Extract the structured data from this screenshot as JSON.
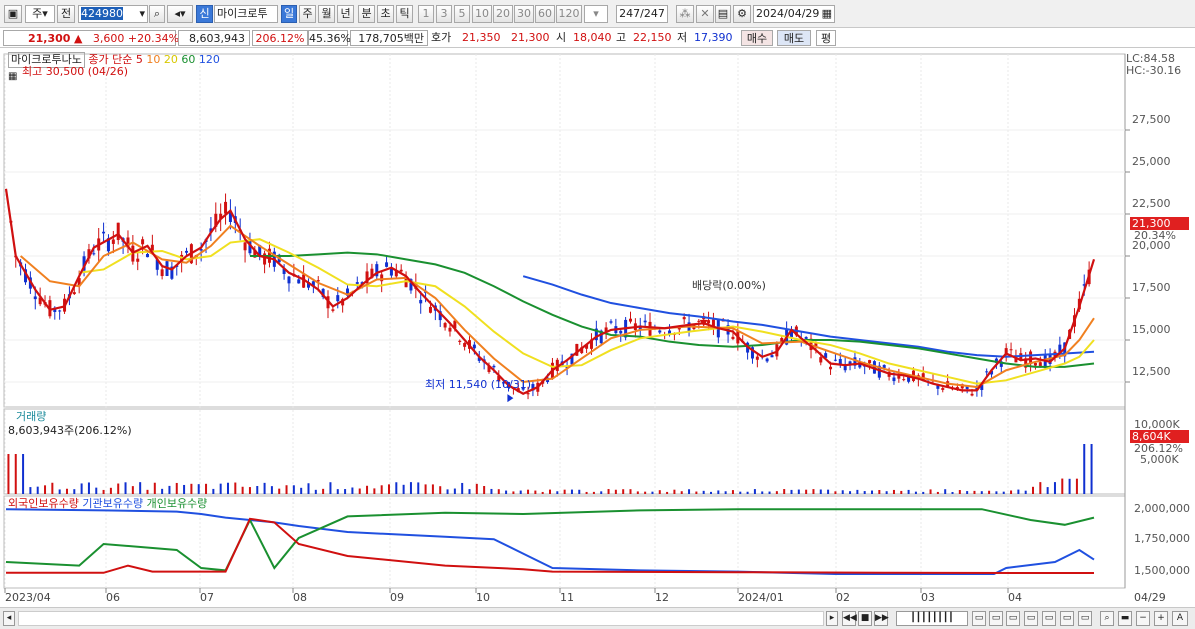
{
  "toolbar": {
    "type_label": "주",
    "prev_label": "전",
    "code": "424980",
    "sel_new": "신",
    "stock_name": "마이크로투",
    "periods": [
      "일",
      "주",
      "월",
      "년",
      "분",
      "초",
      "틱"
    ],
    "intervals": [
      "1",
      "3",
      "5",
      "10",
      "20",
      "30",
      "60",
      "120"
    ],
    "count": "247/247",
    "date": "2024/04/29"
  },
  "info": {
    "price": "21,300",
    "arrow": "▲",
    "change": "3,600",
    "rate": "+20.34%",
    "volume": "8,603,943",
    "vol_rate": "206.12%",
    "turnover": "45.36%",
    "amount": "178,705백만",
    "quote_label": "호가",
    "ask": "21,350",
    "bid": "21,300",
    "open_label": "시",
    "open": "18,040",
    "high_label": "고",
    "high": "22,150",
    "low_label": "저",
    "low": "17,390",
    "buy": "매수",
    "sell": "매도",
    "avg": "평"
  },
  "legend": {
    "name": "마이크로투나노",
    "close": "종가 단순",
    "ma5": "5",
    "ma10": "10",
    "ma20": "20",
    "ma60": "60",
    "ma120": "120",
    "high_note": "최고 30,500 (04/26)",
    "low_note": "최저 11,540 (10/31)",
    "dividend": "배당락(0.00%)"
  },
  "price_axis": {
    "lc": "LC:84.58",
    "hc": "HC:-30.16",
    "ticks": [
      "27,500",
      "25,000",
      "22,500",
      "20,000",
      "17,500",
      "15,000",
      "12,500"
    ],
    "tag_price": "21,300",
    "tag_rate": "20.34%"
  },
  "volume": {
    "title": "거래량",
    "value": "8,603,943주(206.12%)",
    "ticks": [
      "10,000K",
      "5,000K"
    ],
    "tag_vol": "8,604K",
    "tag_rate": "206.12%"
  },
  "holdings": {
    "foreign": "외국인보유수량",
    "inst": "기관보유수량",
    "indiv": "개인보유수량",
    "ticks": [
      "2,000,000",
      "1,750,000",
      "1,500,000"
    ]
  },
  "x_axis": {
    "labels": [
      "2023/04",
      "06",
      "07",
      "08",
      "09",
      "10",
      "11",
      "12",
      "2024/01",
      "02",
      "03",
      "04"
    ],
    "right": "04/29"
  },
  "colors": {
    "up": "#d11010",
    "down": "#1030d0",
    "ma5": "#d01010",
    "ma10": "#f08020",
    "ma20": "#f0e020",
    "ma60": "#1a9030",
    "ma120": "#2050e0"
  },
  "chart_data": {
    "type": "line",
    "series": [
      {
        "name": "종가 단순 5",
        "points": [
          [
            0,
            24000
          ],
          [
            4,
            20000
          ],
          [
            12,
            18000
          ],
          [
            18,
            16800
          ],
          [
            24,
            17000
          ],
          [
            30,
            18800
          ],
          [
            36,
            20500
          ],
          [
            46,
            21300
          ],
          [
            52,
            20200
          ],
          [
            58,
            20600
          ],
          [
            64,
            19400
          ],
          [
            68,
            19200
          ],
          [
            74,
            20000
          ],
          [
            80,
            20500
          ],
          [
            84,
            21400
          ],
          [
            88,
            22200
          ],
          [
            92,
            22700
          ],
          [
            98,
            21000
          ],
          [
            104,
            20000
          ],
          [
            110,
            19800
          ],
          [
            116,
            19000
          ],
          [
            122,
            18600
          ],
          [
            128,
            18000
          ],
          [
            134,
            17000
          ],
          [
            140,
            17500
          ],
          [
            146,
            18300
          ],
          [
            152,
            19000
          ],
          [
            158,
            19300
          ],
          [
            164,
            18800
          ],
          [
            170,
            17800
          ],
          [
            176,
            16900
          ],
          [
            182,
            16000
          ],
          [
            188,
            15000
          ],
          [
            194,
            14000
          ],
          [
            200,
            13200
          ],
          [
            206,
            12300
          ],
          [
            212,
            11800
          ],
          [
            218,
            12200
          ],
          [
            224,
            13200
          ],
          [
            230,
            13800
          ],
          [
            236,
            14500
          ],
          [
            242,
            15200
          ],
          [
            248,
            15600
          ],
          [
            254,
            15700
          ],
          [
            260,
            15800
          ],
          [
            270,
            15700
          ],
          [
            280,
            15900
          ],
          [
            286,
            16000
          ],
          [
            292,
            15700
          ],
          [
            298,
            15500
          ],
          [
            304,
            14600
          ],
          [
            310,
            14000
          ],
          [
            316,
            14300
          ],
          [
            322,
            15600
          ],
          [
            326,
            15100
          ],
          [
            332,
            14400
          ],
          [
            338,
            13600
          ],
          [
            344,
            13500
          ],
          [
            350,
            13600
          ],
          [
            356,
            13300
          ],
          [
            362,
            13000
          ],
          [
            368,
            12900
          ],
          [
            374,
            12700
          ],
          [
            380,
            12400
          ],
          [
            386,
            12200
          ],
          [
            392,
            12000
          ],
          [
            398,
            12000
          ],
          [
            404,
            13200
          ],
          [
            410,
            14200
          ],
          [
            416,
            13800
          ],
          [
            422,
            13900
          ],
          [
            428,
            13700
          ],
          [
            434,
            14500
          ],
          [
            440,
            17000
          ],
          [
            446,
            19800
          ]
        ]
      },
      {
        "name": "10",
        "points": [
          [
            6,
            20000
          ],
          [
            18,
            18500
          ],
          [
            30,
            18200
          ],
          [
            40,
            20000
          ],
          [
            52,
            20800
          ],
          [
            64,
            19800
          ],
          [
            74,
            19600
          ],
          [
            84,
            20600
          ],
          [
            92,
            21800
          ],
          [
            104,
            20600
          ],
          [
            116,
            19500
          ],
          [
            128,
            18400
          ],
          [
            140,
            17700
          ],
          [
            152,
            18600
          ],
          [
            164,
            18700
          ],
          [
            176,
            17500
          ],
          [
            188,
            15600
          ],
          [
            200,
            13900
          ],
          [
            212,
            12500
          ],
          [
            224,
            12700
          ],
          [
            236,
            13900
          ],
          [
            248,
            15100
          ],
          [
            260,
            15600
          ],
          [
            280,
            15800
          ],
          [
            298,
            15700
          ],
          [
            310,
            14800
          ],
          [
            326,
            14900
          ],
          [
            338,
            14300
          ],
          [
            350,
            13700
          ],
          [
            362,
            13200
          ],
          [
            374,
            12800
          ],
          [
            386,
            12400
          ],
          [
            398,
            12200
          ],
          [
            410,
            13200
          ],
          [
            422,
            13700
          ],
          [
            434,
            14100
          ],
          [
            440,
            15000
          ],
          [
            446,
            16300
          ]
        ]
      },
      {
        "name": "20",
        "points": [
          [
            30,
            19000
          ],
          [
            40,
            19200
          ],
          [
            52,
            20200
          ],
          [
            64,
            20300
          ],
          [
            74,
            19800
          ],
          [
            84,
            20000
          ],
          [
            92,
            20800
          ],
          [
            104,
            21000
          ],
          [
            116,
            20200
          ],
          [
            128,
            19300
          ],
          [
            140,
            18300
          ],
          [
            152,
            18200
          ],
          [
            164,
            18500
          ],
          [
            176,
            18200
          ],
          [
            188,
            17000
          ],
          [
            200,
            15500
          ],
          [
            212,
            14200
          ],
          [
            224,
            13400
          ],
          [
            236,
            13500
          ],
          [
            248,
            14400
          ],
          [
            260,
            15100
          ],
          [
            280,
            15500
          ],
          [
            298,
            15800
          ],
          [
            310,
            15500
          ],
          [
            326,
            15000
          ],
          [
            338,
            14700
          ],
          [
            350,
            14200
          ],
          [
            362,
            13600
          ],
          [
            374,
            13200
          ],
          [
            386,
            12800
          ],
          [
            398,
            12400
          ],
          [
            410,
            12600
          ],
          [
            422,
            13100
          ],
          [
            434,
            13600
          ],
          [
            440,
            14000
          ],
          [
            446,
            15000
          ]
        ]
      },
      {
        "name": "60",
        "points": [
          [
            100,
            20000
          ],
          [
            116,
            20000
          ],
          [
            128,
            20100
          ],
          [
            140,
            20200
          ],
          [
            152,
            20100
          ],
          [
            164,
            19800
          ],
          [
            176,
            19500
          ],
          [
            188,
            19000
          ],
          [
            200,
            18200
          ],
          [
            212,
            17300
          ],
          [
            224,
            16500
          ],
          [
            236,
            15800
          ],
          [
            248,
            15300
          ],
          [
            260,
            15200
          ],
          [
            272,
            14900
          ],
          [
            284,
            14700
          ],
          [
            298,
            14600
          ],
          [
            310,
            14700
          ],
          [
            326,
            15000
          ],
          [
            338,
            15000
          ],
          [
            350,
            14900
          ],
          [
            362,
            14700
          ],
          [
            374,
            14500
          ],
          [
            386,
            14200
          ],
          [
            398,
            13900
          ],
          [
            410,
            13600
          ],
          [
            422,
            13400
          ],
          [
            434,
            13400
          ],
          [
            446,
            13600
          ]
        ]
      },
      {
        "name": "120",
        "points": [
          [
            212,
            18800
          ],
          [
            224,
            18300
          ],
          [
            236,
            17700
          ],
          [
            248,
            17200
          ],
          [
            260,
            16900
          ],
          [
            272,
            16600
          ],
          [
            284,
            16400
          ],
          [
            298,
            16100
          ],
          [
            310,
            15900
          ],
          [
            326,
            15500
          ],
          [
            338,
            15200
          ],
          [
            350,
            15000
          ],
          [
            362,
            14800
          ],
          [
            374,
            14600
          ],
          [
            386,
            14300
          ],
          [
            398,
            14100
          ],
          [
            410,
            14000
          ],
          [
            422,
            14100
          ],
          [
            434,
            14200
          ],
          [
            446,
            14300
          ]
        ]
      }
    ],
    "x": [
      0,
      446
    ],
    "ylim": [
      11000,
      30500
    ]
  }
}
